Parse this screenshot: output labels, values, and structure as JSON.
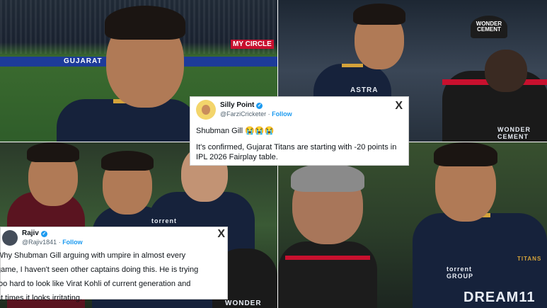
{
  "panels": {
    "top_left": {
      "boards": [
        "GUJARAT",
        "MY CIRCLE"
      ],
      "jersey_text": ""
    },
    "top_right": {
      "jersey_text": "ASTRA",
      "umpire_cap": "WONDER CEMENT",
      "umpire_shirt": "WONDER CEMENT"
    },
    "bottom_left": {
      "jersey_text": "torrent",
      "shirt_text": "WONDER"
    },
    "bottom_right": {
      "jersey_logo": "TITANS",
      "jersey_sponsor": "torrent GROUP",
      "jersey_text": "DREAM11"
    }
  },
  "tweets": [
    {
      "display_name": "Silly Point",
      "handle": "@FarziCricketer",
      "follow_label": "Follow",
      "line1": "Shubman Gill 😭😭😭",
      "line2": "It's confirmed, Gujarat Titans are starting with -20 points in IPL 2026 Fairplay table.",
      "close": "X"
    },
    {
      "display_name": "Rajiv",
      "handle": "@Rajiv1841",
      "follow_label": "Follow",
      "lines": [
        "Why Shubman Gill arguing with umpire in almost every",
        "game, I haven't seen other captains doing this. He is trying",
        "too hard to look like Virat Kohli of current generation and",
        "at times it looks irritating."
      ],
      "close": "X"
    }
  ],
  "colors": {
    "verified": "#1d9bf0",
    "follow": "#1d9bf0",
    "jersey": "#16223b",
    "accent_gold": "#d4a33a"
  }
}
